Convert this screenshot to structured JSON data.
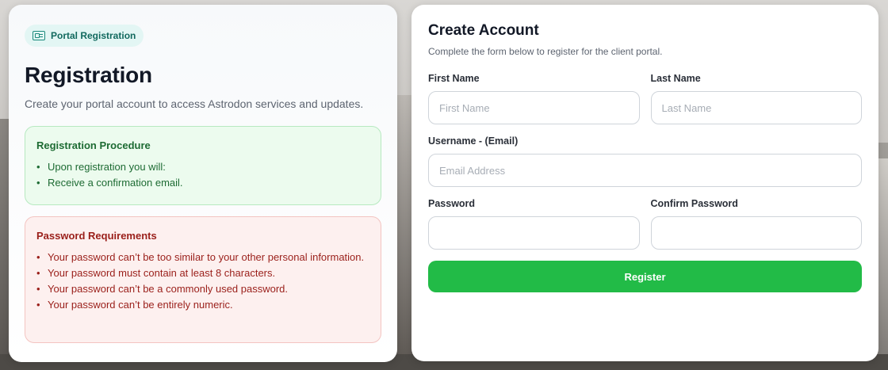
{
  "colors": {
    "accent_green": "#22bb47",
    "pill_bg": "#e3f6f4",
    "pill_text": "#11695e",
    "procedure_bg": "#ecfbee",
    "procedure_text": "#1d6b33",
    "requirements_bg": "#fdf0ef",
    "requirements_text": "#9a1f1a"
  },
  "left": {
    "pill": {
      "icon": "id-card-icon",
      "label": "Portal Registration"
    },
    "title": "Registration",
    "subtitle": "Create your portal account to access Astrodon services and updates.",
    "procedure": {
      "title": "Registration Procedure",
      "items": [
        "Upon registration you will:",
        "Receive a confirmation email."
      ]
    },
    "requirements": {
      "title": "Password Requirements",
      "items": [
        "Your password can’t be too similar to your other personal information.",
        "Your password must contain at least 8 characters.",
        "Your password can’t be a commonly used password.",
        "Your password can’t be entirely numeric."
      ]
    }
  },
  "form": {
    "title": "Create Account",
    "subtitle": "Complete the form below to register for the client portal.",
    "first_name": {
      "label": "First Name",
      "placeholder": "First Name",
      "value": ""
    },
    "last_name": {
      "label": "Last Name",
      "placeholder": "Last Name",
      "value": ""
    },
    "username": {
      "label": "Username - (Email)",
      "placeholder": "Email Address",
      "value": ""
    },
    "password": {
      "label": "Password",
      "placeholder": "",
      "value": ""
    },
    "confirm_password": {
      "label": "Confirm Password",
      "placeholder": "",
      "value": ""
    },
    "submit_label": "Register"
  }
}
